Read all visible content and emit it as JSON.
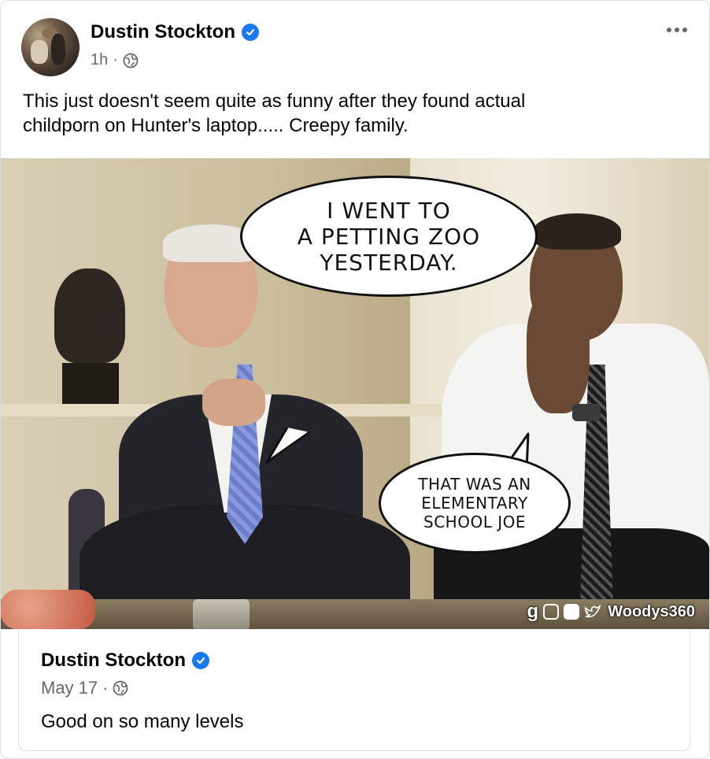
{
  "post": {
    "author": "Dustin Stockton",
    "timestamp": "1h",
    "separator": "·",
    "text_line1": "This just doesn't seem quite as funny after they found actual",
    "text_line2": "childporn on Hunter's laptop..... Creepy family."
  },
  "image": {
    "bubble_top_line1": "I WENT TO",
    "bubble_top_line2": "A PETTING ZOO",
    "bubble_top_line3": "YESTERDAY.",
    "bubble_bottom_line1": "THAT WAS AN",
    "bubble_bottom_line2": "ELEMENTARY",
    "bubble_bottom_line3": "SCHOOL JOE",
    "watermark": "Woodys360"
  },
  "shared": {
    "author": "Dustin Stockton",
    "timestamp": "May 17",
    "separator": "·",
    "text": "Good on so many levels"
  },
  "icons": {
    "verified": "verified-badge-icon",
    "globe": "globe-icon",
    "more": "more-options-icon"
  },
  "colors": {
    "verified_blue": "#1877f2",
    "meta_gray": "#65676b",
    "text": "#050505"
  }
}
